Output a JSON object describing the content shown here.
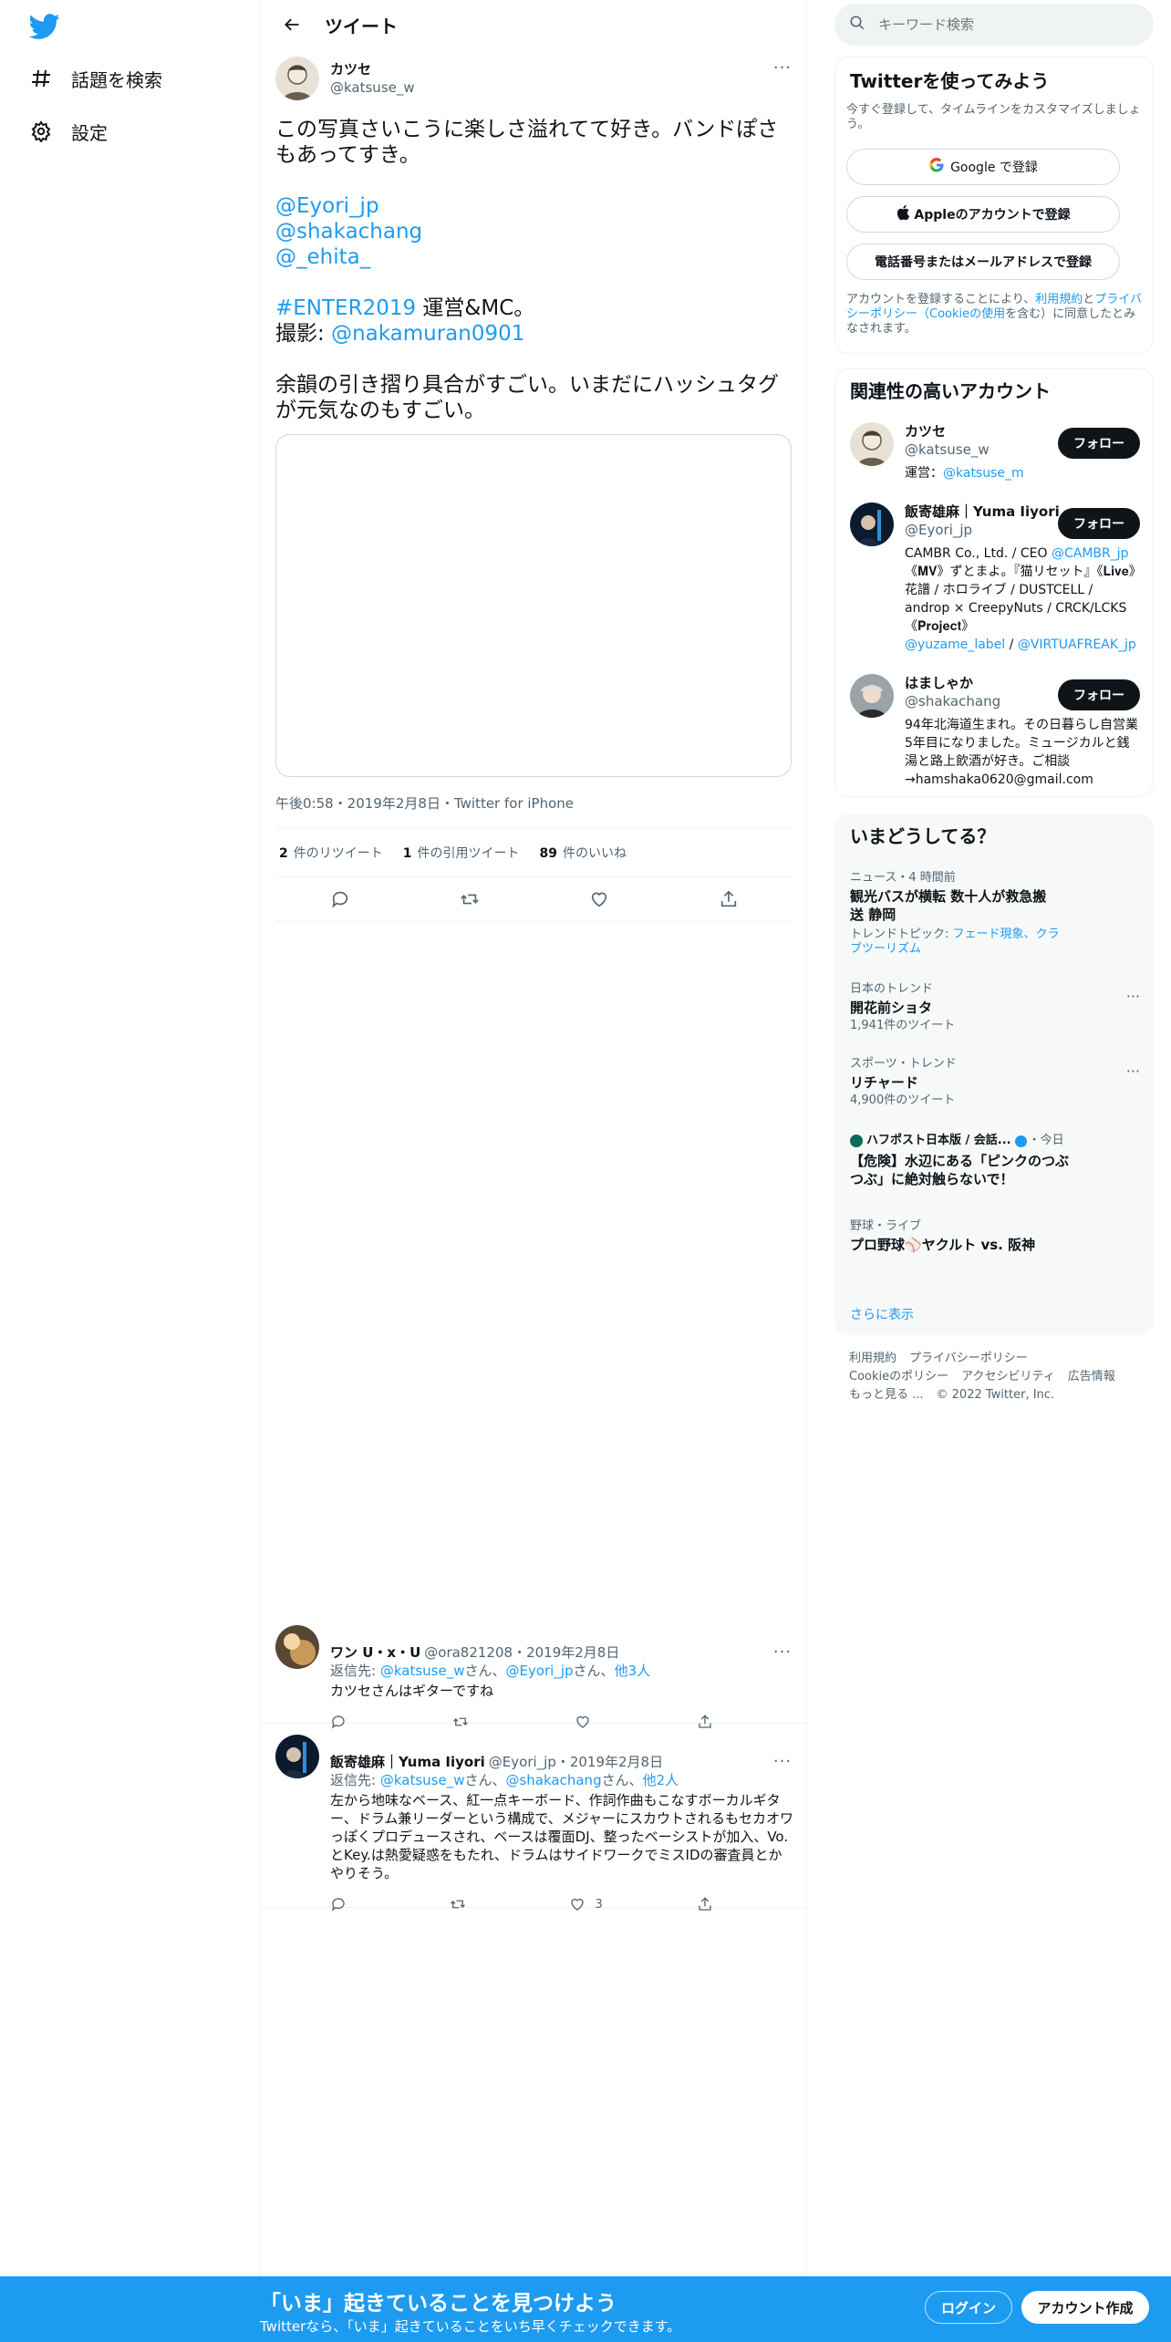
{
  "nav": {
    "explore_label": "話題を検索",
    "settings_label": "設定"
  },
  "header": {
    "title": "ツイート"
  },
  "tweet": {
    "author_name": "カツセ",
    "author_handle": "@katsuse_w",
    "line1": "この写真さいこうに楽しさ溢れてて好き。バンドぽさもあってすき。",
    "mention1": "@Eyori_jp",
    "mention2": "@shakachang",
    "mention3": "@_ehita_",
    "hashtag": "#ENTER2019",
    "hashtag_after": " 運営&MC。",
    "photo_prefix": "撮影: ",
    "photo_mention": "@nakamuran0901",
    "line_last": "余韻の引き摺り具合がすごい。いまだにハッシュタグが元気なのもすごい。",
    "meta": "午後0:58・2019年2月8日・Twitter for iPhone",
    "retweets_count": "2",
    "retweets_label": "件のリツイート",
    "quotes_count": "1",
    "quotes_label": "件の引用ツイート",
    "likes_count": "89",
    "likes_label": "件のいいね"
  },
  "replies": [
    {
      "name": "ワン U・x・U",
      "handle_date": "@ora821208・2019年2月8日",
      "to_prefix": "返信先: ",
      "to_1": "@katsuse_w",
      "to_mid1": "さん、",
      "to_2": "@Eyori_jp",
      "to_mid2": "さん、",
      "to_more": "他3人",
      "text": "カツセさんはギターですね",
      "like_count": ""
    },
    {
      "name": "飯寄雄麻｜Yuma Iiyori",
      "handle_date": "@Eyori_jp・2019年2月8日",
      "to_prefix": "返信先: ",
      "to_1": "@katsuse_w",
      "to_mid1": "さん、",
      "to_2": "@shakachang",
      "to_mid2": "さん、",
      "to_more": "他2人",
      "text": "左から地味なベース、紅一点キーボード、作詞作曲もこなすボーカルギター、ドラム兼リーダーという構成で、メジャーにスカウトされるもセカオワっぽくプロデュースされ、ベースは覆面DJ、整ったベーシストが加入、Vo.とKey.は熱愛疑惑をもたれ、ドラムはサイドワークでミスIDの審査員とかやりそう。",
      "like_count": "3"
    }
  ],
  "search": {
    "placeholder": "キーワード検索"
  },
  "signup_card": {
    "title": "Twitterを使ってみよう",
    "subtitle": "今すぐ登録して、タイムラインをカスタマイズしましょう。",
    "google_btn": "Google で登録",
    "apple_btn": "Appleのアカウントで登録",
    "phone_btn": "電話番号またはメールアドレスで登録",
    "terms_1": "アカウントを登録することにより、",
    "terms_link1": "利用規約",
    "terms_2": "と",
    "terms_link2": "プライバシーポリシー（Cookieの使用",
    "terms_3": "を含む）に同意したとみなされます。"
  },
  "accounts_card": {
    "title": "関連性の高いアカウント",
    "follow_label": "フォロー",
    "accounts": [
      {
        "name": "カツセ",
        "handle": "@katsuse_w",
        "bio_prefix": "運営：",
        "bio_link": "@katsuse_m"
      },
      {
        "name": "飯寄雄麻｜Yuma Iiyori",
        "handle": "@Eyori_jp",
        "bio_prefix": "CAMBR Co., Ltd. / CEO ",
        "bio_link": "@CAMBR_jp",
        "bio_rest": " 《𝐌𝐕》ずとまよ。『猫リセット』《𝐋𝐢𝐯𝐞》花譜 / ホロライブ / DUSTCELL / androp × CreepyNuts / CRCK/LCKS 《𝐏𝐫𝐨𝐣𝐞𝐜𝐭》",
        "bio_link2": "@yuzame_label",
        "bio_sep": " / ",
        "bio_link3": "@VIRTUAFREAK_jp"
      },
      {
        "name": "はましゃか",
        "handle": "@shakachang",
        "bio_prefix": "94年北海道生まれ。その日暮らし自営業5年目になりました。ミュージカルと銭湯と路上飲酒が好き。ご相談→hamshaka0620@gmail.com"
      }
    ]
  },
  "trends_card": {
    "title": "いまどうしてる？",
    "items": [
      {
        "context": "ニュース・4 時間前",
        "title": "観光バスが横転 数十人が救急搬送 静岡",
        "topic_prefix": "トレンドトピック: ",
        "topic_links": "フェード現象、クラブツーリズム"
      },
      {
        "context": "日本のトレンド",
        "title": "開花前ショタ",
        "count": "1,941件のツイート"
      },
      {
        "context": "スポーツ・トレンド",
        "title": "リチャード",
        "count": "4,900件のツイート"
      },
      {
        "context_source": "ハフポスト日本版 / 会話...",
        "context_time": "・今日",
        "title": "【危険】水辺にある「ピンクのつぶつぶ」に絶対触らないで！"
      },
      {
        "context": "野球・ライブ",
        "title_prefix": "プロ野球",
        "title_rest": "ヤクルト vs. 阪神"
      }
    ],
    "show_more": "さらに表示"
  },
  "footer": {
    "links_row1": [
      "利用規約",
      "プライバシーポリシー"
    ],
    "links_row2": [
      "Cookieのポリシー",
      "アクセシビリティ",
      "広告情報"
    ],
    "more": "もっと見る ...",
    "copyright": "© 2022 Twitter, Inc."
  },
  "bottom_bar": {
    "title": "「いま」起きていることを見つけよう",
    "subtitle": "Twitterなら、「いま」起きていることをいち早くチェックできます。",
    "login": "ログイン",
    "signup": "アカウント作成"
  },
  "colors": {
    "accent": "#1d9bf0",
    "text": "#0f1419",
    "secondary": "#536471"
  }
}
